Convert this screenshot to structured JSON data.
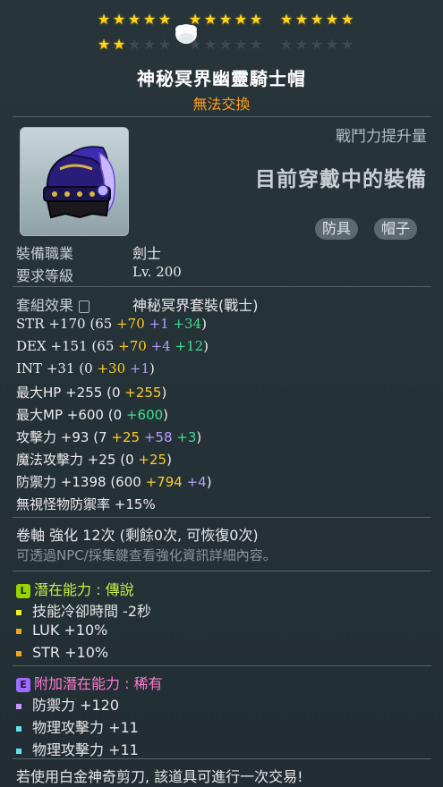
{
  "stars": {
    "total": 25,
    "filled": 17
  },
  "item": {
    "name": "神秘冥界幽靈騎士帽",
    "trade_status": "無法交換",
    "compare_label": "戰鬥力提升量",
    "currently_equipped": "目前穿戴中的裝備",
    "tags": [
      "防具",
      "帽子"
    ],
    "job_label": "裝備職業",
    "job_value": "劍士",
    "level_label": "要求等級",
    "level_value": "Lv. 200",
    "set_label": "套組效果",
    "set_value": "神秘冥界套裝(戰士)"
  },
  "stats": [
    {
      "name": "STR",
      "total": "+170",
      "base": "(65",
      "parts": [
        {
          "t": "+70",
          "c": "yellow"
        },
        {
          "t": "+1",
          "c": "purple"
        },
        {
          "t": "+34",
          "c": "green"
        }
      ],
      "end": ")"
    },
    {
      "name": "DEX",
      "total": "+151",
      "base": "(65",
      "parts": [
        {
          "t": "+70",
          "c": "yellow"
        },
        {
          "t": "+4",
          "c": "purple"
        },
        {
          "t": "+12",
          "c": "green"
        }
      ],
      "end": ")"
    },
    {
      "name": "INT",
      "total": "+31",
      "base": "(0",
      "parts": [
        {
          "t": "+30",
          "c": "yellow"
        },
        {
          "t": "+1",
          "c": "purple"
        }
      ],
      "end": ")"
    },
    {
      "name": "最大HP",
      "total": "+255",
      "base": "(0",
      "parts": [
        {
          "t": "+255",
          "c": "yellow"
        }
      ],
      "end": ")"
    },
    {
      "name": "最大MP",
      "total": "+600",
      "base": "(0",
      "parts": [
        {
          "t": "+600",
          "c": "green"
        }
      ],
      "end": ")"
    },
    {
      "name": "攻擊力",
      "total": "+93",
      "base": "(7",
      "parts": [
        {
          "t": "+25",
          "c": "yellow"
        },
        {
          "t": "+58",
          "c": "purple"
        },
        {
          "t": "+3",
          "c": "green"
        }
      ],
      "end": ")"
    },
    {
      "name": "魔法攻擊力",
      "total": "+25",
      "base": "(0",
      "parts": [
        {
          "t": "+25",
          "c": "yellow"
        }
      ],
      "end": ")"
    },
    {
      "name": "防禦力",
      "total": "+1398",
      "base": "(600",
      "parts": [
        {
          "t": "+794",
          "c": "yellow"
        },
        {
          "t": "+4",
          "c": "purple"
        }
      ],
      "end": ")"
    },
    {
      "name": "無視怪物防禦率",
      "total": "+15%",
      "base": "",
      "parts": [],
      "end": ""
    }
  ],
  "scroll": {
    "text": "卷軸 強化 12次 (剩餘0次, 可恢復0次)",
    "hint": "可透過NPC/採集鍵查看強化資訊詳細內容。"
  },
  "potential": {
    "badge": "L",
    "title": "潛在能力 : 傳說",
    "lines": [
      {
        "text": "技能冷卻時間 -2秒",
        "bullet": "y"
      },
      {
        "text": "LUK +10%",
        "bullet": "o"
      },
      {
        "text": "STR +10%",
        "bullet": "o"
      }
    ]
  },
  "additional": {
    "badge": "E",
    "title": "附加潛在能力 : 稀有",
    "lines": [
      {
        "text": "防禦力 +120",
        "bullet": "p"
      },
      {
        "text": "物理攻擊力 +11",
        "bullet": "c"
      },
      {
        "text": "物理攻擊力 +11",
        "bullet": "c"
      }
    ]
  },
  "footer": "若使用白金神奇剪刀, 該道具可進行一次交易!"
}
